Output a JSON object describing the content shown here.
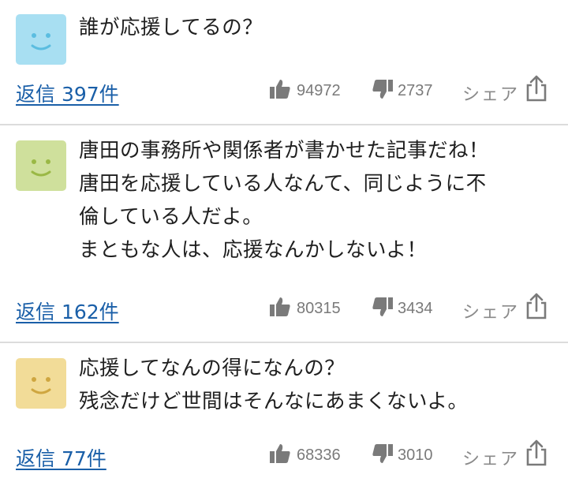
{
  "comments": [
    {
      "avatar_color": "#a8dff2",
      "face_color": "#5bbde0",
      "lines": [
        "誰が応援してるの？"
      ],
      "reply_label": "返信 397件",
      "likes": "94972",
      "dislikes": "2737",
      "share_label": "シェア"
    },
    {
      "avatar_color": "#cfe09c",
      "face_color": "#9ab845",
      "lines": [
        "唐田の事務所や関係者が書かせた記事だね！",
        "唐田を応援している人なんて、同じように不",
        "倫している人だよ。",
        "まともな人は、応援なんかしないよ！"
      ],
      "reply_label": "返信 162件",
      "likes": "80315",
      "dislikes": "3434",
      "share_label": "シェア"
    },
    {
      "avatar_color": "#f2dc98",
      "face_color": "#cfa640",
      "lines": [
        "応援してなんの得になんの？",
        "残念だけど世間はそんなにあまくないよ。"
      ],
      "reply_label": "返信 77件",
      "likes": "68336",
      "dislikes": "3010",
      "share_label": "シェア"
    }
  ],
  "icons": {
    "like": "thumbs-up-icon",
    "dislike": "thumbs-down-icon",
    "share": "share-icon"
  },
  "colors": {
    "link": "#1a5fa8",
    "muted": "#7a7a7a",
    "divider": "#dcdcdc"
  }
}
